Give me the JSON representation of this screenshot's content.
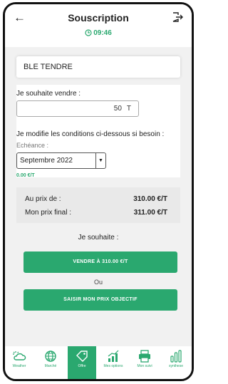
{
  "header": {
    "title": "Souscription",
    "timer": "09:46"
  },
  "product": {
    "name": "BLE TENDRE"
  },
  "form": {
    "sell_label": "Je souhaite vendre :",
    "quantity": "50",
    "unit": "T",
    "conditions_label": "Je modifie les conditions ci-dessous si besoin :",
    "echeance_label": "Echéance :",
    "echeance_value": "Septembre 2022",
    "premium": "0.00 €/T"
  },
  "prices": {
    "market_label": "Au prix de :",
    "market_value": "310.00 €/T",
    "final_label": "Mon prix final :",
    "final_value": "311.00 €/T"
  },
  "actions": {
    "wish_label": "Je souhaite :",
    "sell_button": "VENDRE À 310.00 €/T",
    "or_label": "Ou",
    "target_button": "SAISIR MON PRIX OBJECTIF"
  },
  "nav": {
    "items": [
      {
        "label": "Weather",
        "icon": "weather-icon"
      },
      {
        "label": "Marché",
        "icon": "globe-icon"
      },
      {
        "label": "Offre",
        "icon": "tag-icon"
      },
      {
        "label": "Mes options",
        "icon": "options-chart-icon"
      },
      {
        "label": "Mon suivi",
        "icon": "printer-icon"
      },
      {
        "label": "synthese",
        "icon": "bar-chart-icon"
      }
    ],
    "active_index": 2
  },
  "colors": {
    "accent": "#2aa86f",
    "background": "#f1f1f1"
  }
}
